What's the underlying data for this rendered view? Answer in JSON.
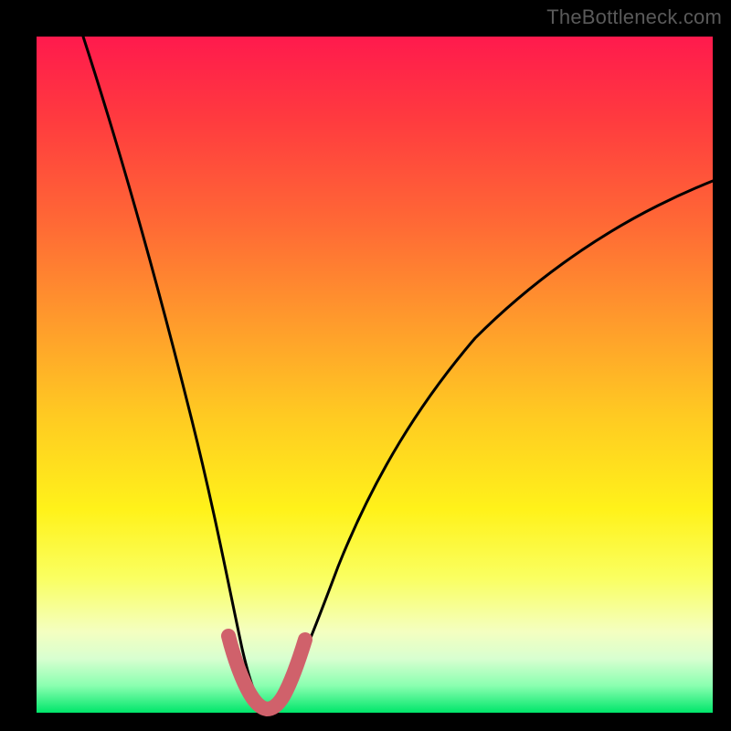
{
  "watermark": "TheBottleneck.com",
  "chart_data": {
    "type": "line",
    "title": "",
    "xlabel": "",
    "ylabel": "",
    "xlim": [
      0,
      100
    ],
    "ylim": [
      0,
      100
    ],
    "series": [
      {
        "name": "black-curve",
        "x": [
          7,
          10,
          13,
          16,
          19,
          22,
          25,
          28,
          29.5,
          31,
          33,
          35,
          37,
          40,
          44,
          48,
          53,
          58,
          64,
          70,
          76,
          83,
          90,
          97,
          100
        ],
        "y": [
          100,
          83,
          70,
          58,
          47,
          37,
          27,
          17,
          11,
          6,
          3,
          2,
          4,
          10,
          20,
          30,
          40,
          49,
          56,
          62,
          67,
          71,
          75,
          78,
          79
        ]
      },
      {
        "name": "pink-accent",
        "x": [
          28,
          29,
          30,
          31,
          32,
          33,
          34,
          35,
          36,
          37,
          38
        ],
        "y": [
          11,
          8,
          5.5,
          3.5,
          2.5,
          2,
          2.5,
          3.5,
          5.5,
          8,
          11
        ]
      }
    ],
    "colors": {
      "curve": "#000000",
      "accent": "#d0616b",
      "gradient_top": "#ff1a4d",
      "gradient_bottom": "#00e66a"
    }
  }
}
